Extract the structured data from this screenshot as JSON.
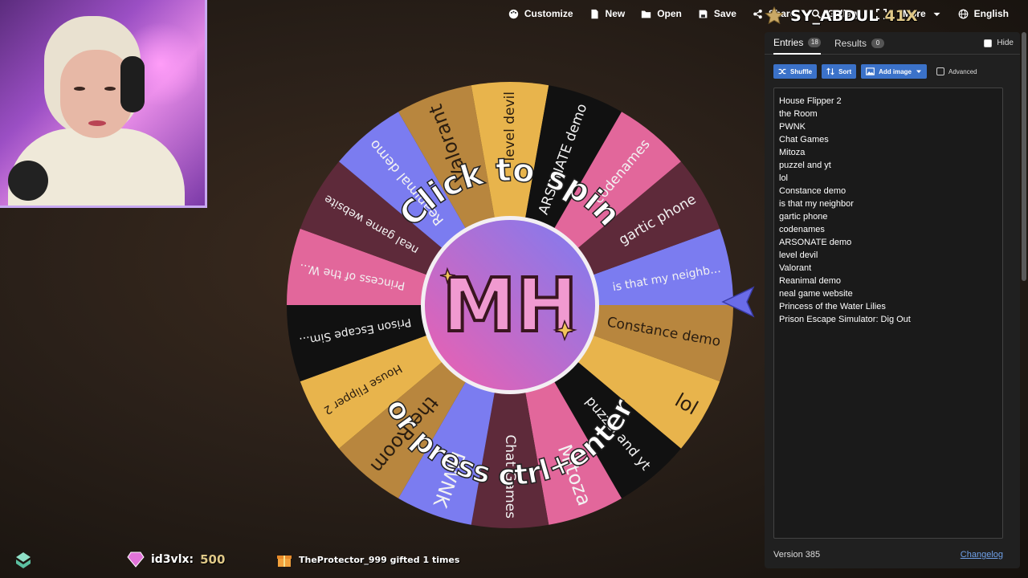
{
  "topbar": {
    "items": [
      {
        "label": "Customize",
        "icon": "palette-icon"
      },
      {
        "label": "New",
        "icon": "file-icon"
      },
      {
        "label": "Open",
        "icon": "folder-open-icon"
      },
      {
        "label": "Save",
        "icon": "floppy-icon"
      },
      {
        "label": "Share",
        "icon": "share-icon"
      },
      {
        "label": "Gallery",
        "icon": "search-icon"
      },
      {
        "label": "",
        "icon": "fullscreen-icon"
      },
      {
        "label": "More",
        "icon": "chevron-down-icon"
      },
      {
        "label": "English",
        "icon": "globe-icon"
      }
    ]
  },
  "overlay": {
    "username": "SY_ABDUL",
    "number": "41X",
    "bottom": {
      "gem_user": "id3vlx:",
      "gem_value": "500",
      "gift_text": "TheProtector_999 gifted 1 times"
    }
  },
  "wheel": {
    "spin_text_top": "Click to spin",
    "spin_text_bottom": "or press ctrl+enter",
    "center_logo": "MH",
    "slices": [
      "is that my neighb...",
      "Constance demo",
      "lol",
      "puzzel and yt",
      "Mitoza",
      "Chat Games",
      "PWNK",
      "the Room",
      "House Flipper 2",
      "Prison Escape Sim...",
      "Princess of the W...",
      "neal game website",
      "Reanimal demo",
      "Valorant",
      "level devil",
      "ARSONATE demo",
      "codenames",
      "gartic phone"
    ],
    "colors": [
      "#7b7cf0",
      "#b8863e",
      "#e8b44c",
      "#111111",
      "#e2679b",
      "#5e2a3a"
    ]
  },
  "panel": {
    "tabs": [
      {
        "label": "Entries",
        "count": "18"
      },
      {
        "label": "Results",
        "count": "0"
      }
    ],
    "hide_label": "Hide",
    "buttons": {
      "shuffle": "Shuffle",
      "sort": "Sort",
      "add_image": "Add image",
      "advanced": "Advanced"
    },
    "entries": [
      "House Flipper 2",
      "the Room",
      "PWNK",
      "Chat Games",
      "Mitoza",
      "puzzel and yt",
      "lol",
      "Constance demo",
      "is that my neighbor",
      "gartic phone",
      "codenames",
      "ARSONATE demo",
      "level devil",
      "Valorant",
      "Reanimal demo",
      "neal game website",
      "Princess of the Water Lilies",
      "Prison Escape Simulator: Dig Out"
    ],
    "version": "Version 385",
    "changelog": "Changelog"
  }
}
